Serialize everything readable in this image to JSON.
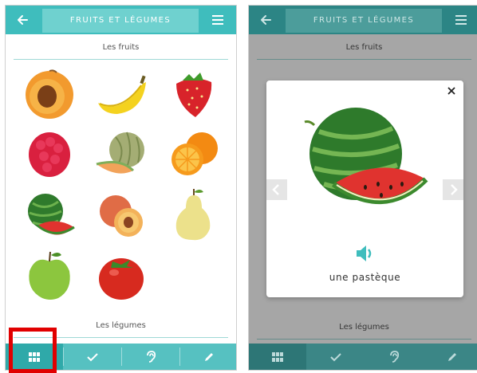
{
  "left_screen": {
    "appbar": {
      "title": "FRUITS ET LÉGUMES",
      "back_icon": "arrow-left-icon",
      "menu_icon": "menu-icon"
    },
    "sections": {
      "fruits": "Les fruits",
      "vegetables": "Les légumes"
    },
    "fruits": [
      {
        "name": "apricot"
      },
      {
        "name": "banana"
      },
      {
        "name": "strawberry"
      },
      {
        "name": "raspberry"
      },
      {
        "name": "melon"
      },
      {
        "name": "orange"
      },
      {
        "name": "watermelon"
      },
      {
        "name": "peach"
      },
      {
        "name": "pear"
      },
      {
        "name": "apple"
      },
      {
        "name": "tomato"
      }
    ],
    "tabs": [
      {
        "icon": "grid-icon",
        "active": true
      },
      {
        "icon": "check-icon",
        "active": false
      },
      {
        "icon": "ear-icon",
        "active": false
      },
      {
        "icon": "pencil-icon",
        "active": false
      }
    ]
  },
  "right_screen": {
    "appbar": {
      "title": "FRUITS ET LÉGUMES"
    },
    "sections": {
      "fruits": "Les fruits",
      "vegetables": "Les légumes"
    },
    "modal": {
      "word": "une pastèque",
      "image": "watermelon",
      "close_icon": "close-icon",
      "speaker_icon": "speaker-icon",
      "prev_icon": "chevron-left-icon",
      "next_icon": "chevron-right-icon"
    }
  },
  "colors": {
    "teal": "#3fbdbd",
    "teal_light": "#6fd1cf",
    "highlight": "#e10000"
  }
}
